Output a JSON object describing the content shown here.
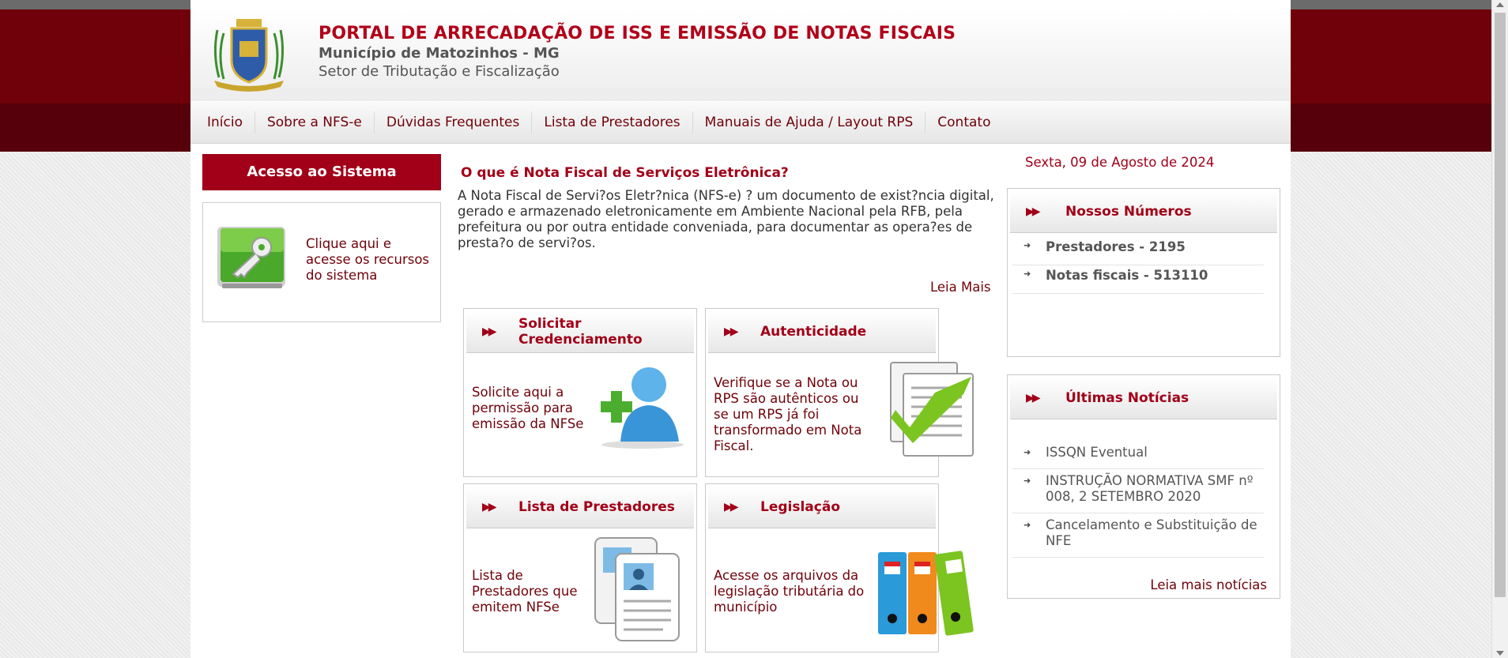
{
  "header": {
    "title": "PORTAL DE ARRECADAÇÃO DE ISS E EMISSÃO DE NOTAS FISCAIS",
    "municipality": "Município de Matozinhos - MG",
    "sector": "Setor de Tributação e Fiscalização",
    "logo_icon": "municipal-coat-of-arms-icon"
  },
  "nav": {
    "items": [
      {
        "label": "Início"
      },
      {
        "label": "Sobre a NFS-e"
      },
      {
        "label": "Dúvidas Frequentes"
      },
      {
        "label": "Lista de Prestadores"
      },
      {
        "label": "Manuais de Ajuda / Layout RPS"
      },
      {
        "label": "Contato"
      }
    ]
  },
  "access": {
    "title": "Acesso ao Sistema",
    "text": "Clique aqui e acesse os recursos do sistema",
    "icon": "key-icon"
  },
  "main": {
    "title": "O que é Nota Fiscal de Serviços Eletrônica?",
    "body": "A Nota Fiscal de Servi?os Eletr?nica (NFS-e) ? um documento de exist?ncia digital, gerado e armazenado eletronicamente em Ambiente Nacional pela RFB, pela prefeitura ou por outra entidade conveniada, para documentar as opera?es de presta?o de servi?os.",
    "read_more": "Leia Mais"
  },
  "cards": [
    {
      "title": "Solicitar Credenciamento",
      "text": "Solicite aqui a permissão para emissão da NFSe",
      "icon": "add-user-icon"
    },
    {
      "title": "Autenticidade",
      "text": "Verifique se a Nota ou RPS são autênticos ou se um RPS já foi transformado em Nota Fiscal.",
      "icon": "verified-document-icon"
    },
    {
      "title": "Lista de Prestadores",
      "text": "Lista de Prestadores que emitem NFSe",
      "icon": "contact-cards-icon"
    },
    {
      "title": "Legislação",
      "text": "Acesse os arquivos da legislação tributária do município",
      "icon": "binders-icon"
    }
  ],
  "sidebar": {
    "date": "Sexta, 09 de Agosto de 2024",
    "numbers": {
      "title": "Nossos Números",
      "items": [
        {
          "label": "Prestadores - 2195"
        },
        {
          "label": "Notas fiscais - 513110"
        }
      ]
    },
    "news": {
      "title": "Últimas Notícias",
      "items": [
        {
          "label": "ISSQN Eventual"
        },
        {
          "label": "INSTRUÇÃO NORMATIVA SMF nº 008, 2 SETEMBRO 2020"
        },
        {
          "label": "Cancelamento e Substituição de NFE"
        }
      ],
      "more": "Leia mais notícias"
    }
  },
  "colors": {
    "brand_red": "#a10018",
    "dark_red": "#700009"
  }
}
